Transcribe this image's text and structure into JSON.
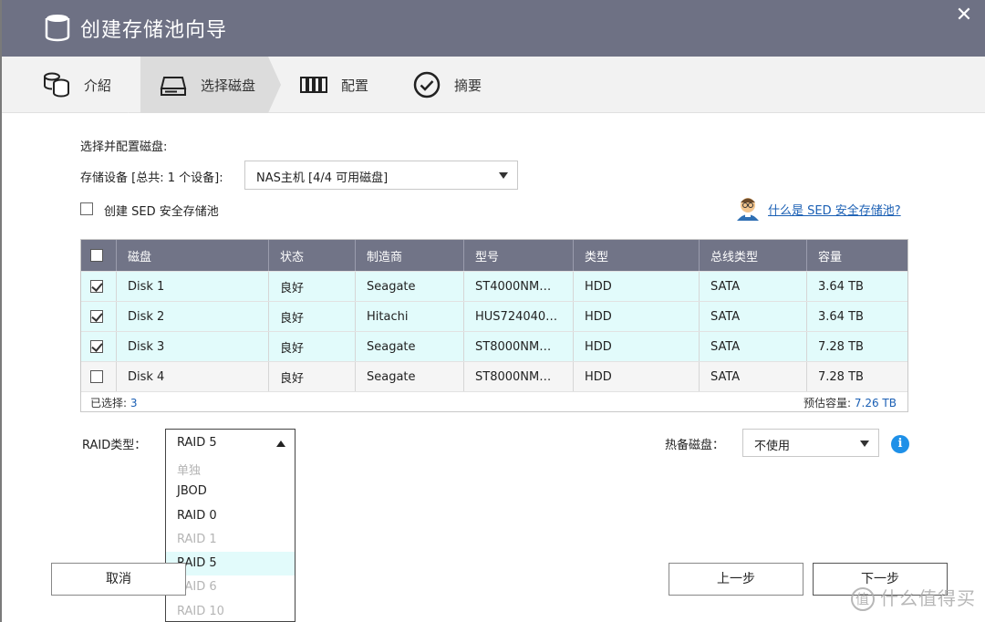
{
  "window": {
    "title": "创建存储池向导",
    "close_label": "✕"
  },
  "steps": [
    {
      "label": "介紹",
      "icon": "database-icon",
      "active": false
    },
    {
      "label": "选择磁盘",
      "icon": "drive-icon",
      "active": true
    },
    {
      "label": "配置",
      "icon": "config-icon",
      "active": false
    },
    {
      "label": "摘要",
      "icon": "check-circle-icon",
      "active": false
    }
  ],
  "form": {
    "section_title": "选择并配置磁盘:",
    "device_label": "存储设备 [总共: 1 个设备]:",
    "device_value": "NAS主机 [4/4 可用磁盘]",
    "sed_label": "创建 SED 安全存储池",
    "sed_help_link": "什么是 SED 安全存储池?"
  },
  "table": {
    "headers": [
      "磁盘",
      "状态",
      "制造商",
      "型号",
      "类型",
      "总线类型",
      "容量"
    ],
    "rows": [
      {
        "checked": true,
        "disk": "Disk 1",
        "status": "良好",
        "vendor": "Seagate",
        "model": "ST4000NM…",
        "type": "HDD",
        "bus": "SATA",
        "capacity": "3.64 TB"
      },
      {
        "checked": true,
        "disk": "Disk 2",
        "status": "良好",
        "vendor": "Hitachi",
        "model": "HUS724040…",
        "type": "HDD",
        "bus": "SATA",
        "capacity": "3.64 TB"
      },
      {
        "checked": true,
        "disk": "Disk 3",
        "status": "良好",
        "vendor": "Seagate",
        "model": "ST8000NM…",
        "type": "HDD",
        "bus": "SATA",
        "capacity": "7.28 TB"
      },
      {
        "checked": false,
        "disk": "Disk 4",
        "status": "良好",
        "vendor": "Seagate",
        "model": "ST8000NM…",
        "type": "HDD",
        "bus": "SATA",
        "capacity": "7.28 TB"
      }
    ],
    "selected_label": "已选择:",
    "selected_count": "3",
    "estimated_label": "预估容量:",
    "estimated_value": "7.26 TB"
  },
  "raid": {
    "label": "RAID类型：",
    "value": "RAID 5",
    "options": [
      {
        "label": "单独",
        "disabled": true
      },
      {
        "label": "JBOD",
        "disabled": false
      },
      {
        "label": "RAID 0",
        "disabled": false
      },
      {
        "label": "RAID 1",
        "disabled": true
      },
      {
        "label": "RAID 5",
        "disabled": false,
        "highlighted": true
      },
      {
        "label": "RAID 6",
        "disabled": true
      },
      {
        "label": "RAID 10",
        "disabled": true
      }
    ]
  },
  "spare": {
    "label": "热备磁盘：",
    "value": "不使用",
    "info_icon": "i"
  },
  "buttons": {
    "cancel": "取消",
    "prev": "上一步",
    "next": "下一步"
  },
  "watermark": {
    "badge": "值",
    "text": "什么值得买"
  },
  "colors": {
    "titlebar": "#6e7184",
    "table_header": "#717487",
    "selected_row": "#e2fbfb",
    "link": "#1a5fb4",
    "info": "#1e90e8"
  }
}
